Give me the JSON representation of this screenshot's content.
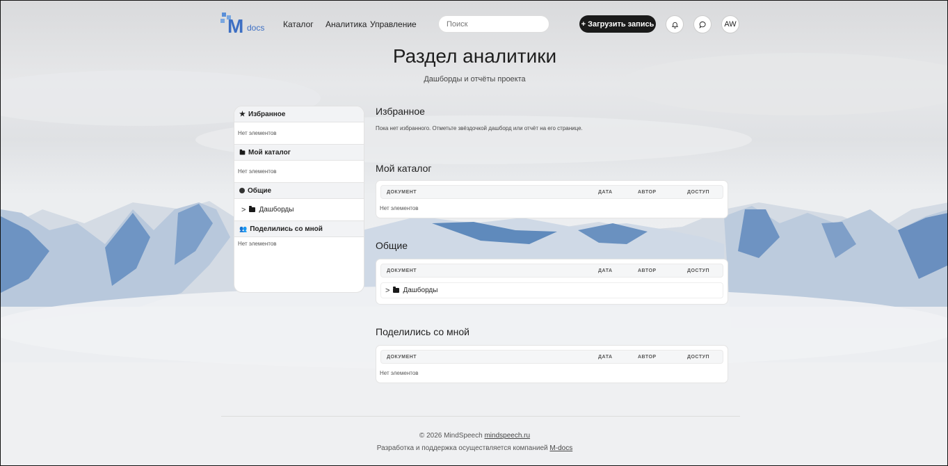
{
  "header": {
    "logo_letter": "M",
    "logo_text": "docs",
    "nav": [
      "Каталог",
      "Аналитика",
      "Управление"
    ],
    "search_placeholder": "Поиск",
    "upload_label": "+ Загрузить запись",
    "avatar": "AW"
  },
  "page": {
    "title": "Раздел аналитики",
    "subtitle": "Дашборды и отчёты проекта"
  },
  "sidebar": {
    "favorites": {
      "title": "Избранное",
      "empty": "Нет элементов"
    },
    "my_catalog": {
      "title": "Мой каталог",
      "empty": "Нет элементов"
    },
    "shared": {
      "title": "Общие",
      "folder": "Дашборды"
    },
    "shared_with_me": {
      "title": "Поделились со мной",
      "empty": "Нет элементов"
    }
  },
  "main": {
    "favorites": {
      "title": "Избранное",
      "text": "Пока нет избранного. Отметьте звёздочкой дашборд или отчёт на его странице."
    },
    "my_catalog": {
      "title": "Мой каталог",
      "empty": "Нет элементов"
    },
    "shared": {
      "title": "Общие",
      "folder": "Дашборды"
    },
    "shared_with_me": {
      "title": "Поделились со мной",
      "empty": "Нет элементов"
    },
    "columns": {
      "document": "ДОКУМЕНТ",
      "date": "ДАТА",
      "author": "АВТОР",
      "access": "ДОСТУП"
    }
  },
  "footer": {
    "copyright": "© 2026 MindSpeech",
    "site_link": "mindspeech.ru",
    "dev_text": "Разработка и поддержка осуществляется компанией",
    "company_link": "M-docs"
  },
  "colors": {
    "accent": "#3d6fc3",
    "button_dark": "#1a1a1a",
    "mountain_blue": "#5b86b8"
  }
}
